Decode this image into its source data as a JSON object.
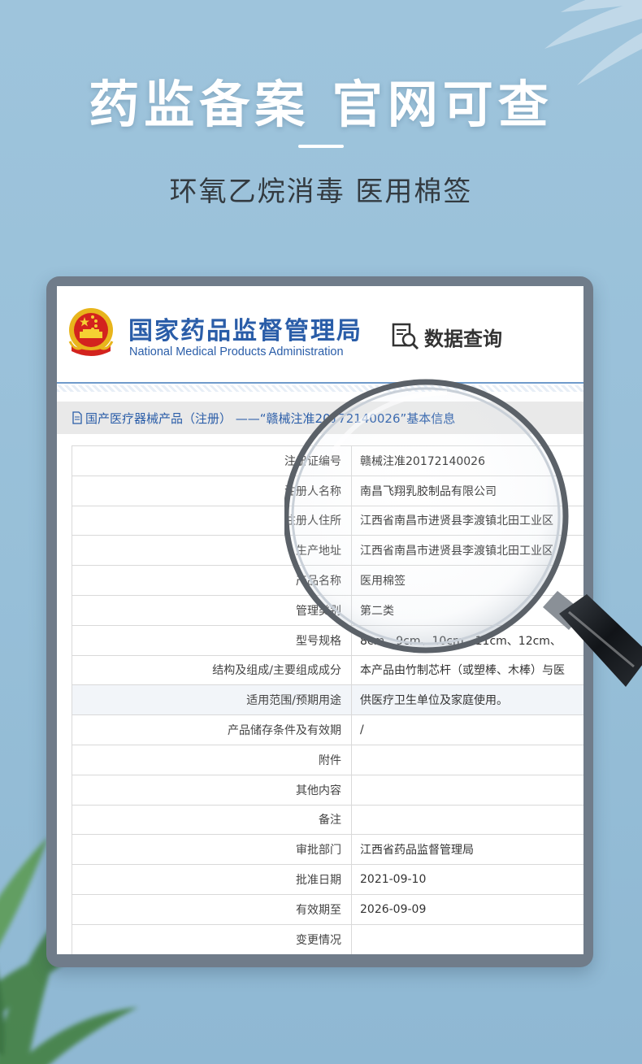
{
  "headline": "药监备案  官网可查",
  "subline": "环氧乙烷消毒 医用棉签",
  "site": {
    "agency_cn": "国家药品监督管理局",
    "agency_en": "National Medical Products Administration",
    "data_query_label": "数据查询"
  },
  "breadcrumb": "国产医疗器械产品（注册） ——“赣械注准20172140026”基本信息",
  "record": [
    {
      "key": "注册证编号",
      "value": "赣械注准20172140026"
    },
    {
      "key": "注册人名称",
      "value": "南昌飞翔乳胶制品有限公司"
    },
    {
      "key": "注册人住所",
      "value": "江西省南昌市进贤县李渡镇北田工业区"
    },
    {
      "key": "生产地址",
      "value": "江西省南昌市进贤县李渡镇北田工业区"
    },
    {
      "key": "产品名称",
      "value": "医用棉签"
    },
    {
      "key": "管理类别",
      "value": "第二类"
    },
    {
      "key": "型号规格",
      "value": "8cm、9cm、10cm、11cm、12cm、"
    },
    {
      "key": "结构及组成/主要组成成分",
      "value": "本产品由竹制芯杆（或塑棒、木棒）与医"
    },
    {
      "key": "适用范围/预期用途",
      "value": "供医疗卫生单位及家庭使用。"
    },
    {
      "key": "产品储存条件及有效期",
      "value": "/"
    },
    {
      "key": "附件",
      "value": ""
    },
    {
      "key": "其他内容",
      "value": ""
    },
    {
      "key": "备注",
      "value": ""
    },
    {
      "key": "审批部门",
      "value": "江西省药品监督管理局"
    },
    {
      "key": "批准日期",
      "value": "2021-09-10"
    },
    {
      "key": "有效期至",
      "value": "2026-09-09"
    },
    {
      "key": "变更情况",
      "value": ""
    }
  ],
  "colors": {
    "brand_blue": "#2a5da8",
    "background": "#9ec4dc",
    "frame": "#707c8a"
  },
  "icons": [
    "national-emblem-icon",
    "data-search-icon",
    "document-icon",
    "magnifying-glass-icon"
  ]
}
